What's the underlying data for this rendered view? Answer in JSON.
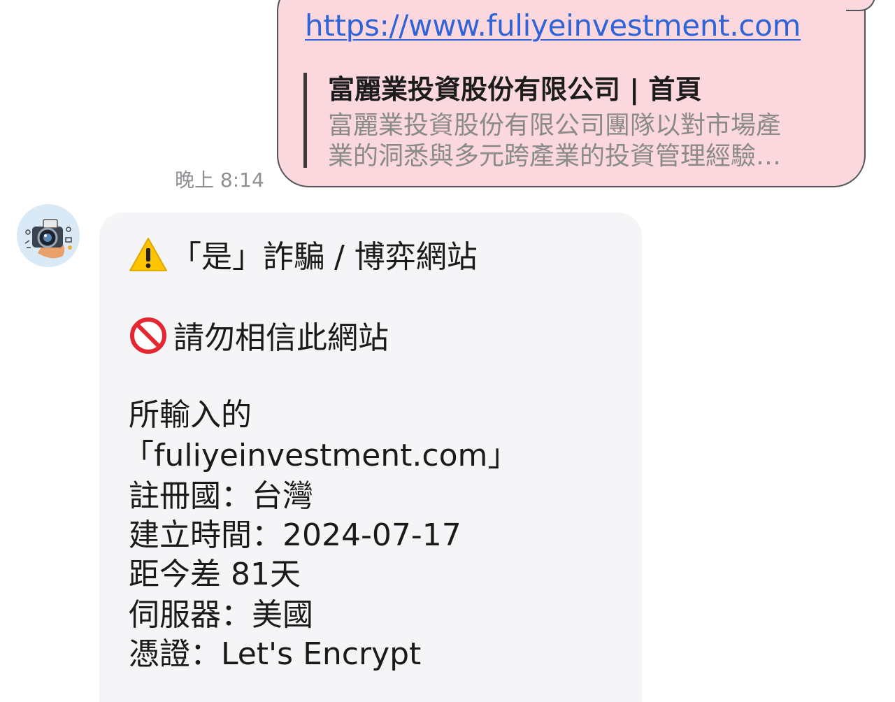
{
  "outgoing": {
    "link": "https://www.fuliyeinvestment.com",
    "preview_title": "富麗業投資股份有限公司 | 首頁",
    "preview_desc_line1": "富麗業投資股份有限公司團隊以對市場產",
    "preview_desc_line2": "業的洞悉與多元跨產業的投資管理經驗…",
    "time": "晚上 8:14"
  },
  "reply": {
    "verdict": "「是」詐騙 / 博弈網站",
    "warning": "請勿相信此網站",
    "details_label": "所輸入的",
    "domain": "「fuliyeinvestment.com」",
    "country": "註冊國：台灣",
    "created": "建立時間：2024-07-17",
    "age": "距今差 81天",
    "server": "伺服器：美國",
    "cert": "憑證：Let's Encrypt"
  },
  "colors": {
    "outgoing_bubble": "#fbd8de",
    "incoming_bubble": "#f5f5f7",
    "link": "#2f64d8"
  },
  "icons": {
    "verdict_icon": "warning-icon",
    "warning_icon": "prohibited-icon",
    "avatar": "camera-avatar"
  }
}
